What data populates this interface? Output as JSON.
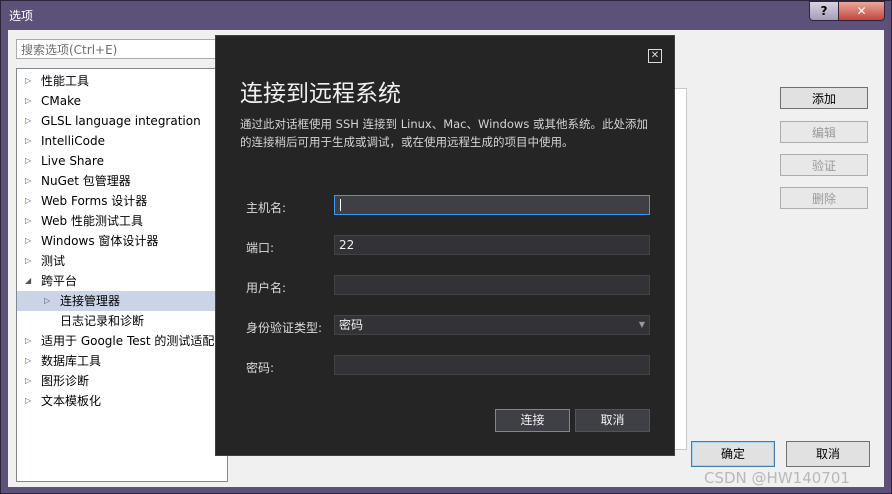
{
  "window": {
    "title": "选项",
    "help_glyph": "?",
    "close_glyph": "✕"
  },
  "search": {
    "placeholder": "搜索选项(Ctrl+E)"
  },
  "tree": {
    "items": [
      {
        "label": "性能工具",
        "expandable": true,
        "indent": 0,
        "selected": false
      },
      {
        "label": "CMake",
        "expandable": true,
        "indent": 0,
        "selected": false
      },
      {
        "label": "GLSL language integration",
        "expandable": true,
        "indent": 0,
        "selected": false
      },
      {
        "label": "IntelliCode",
        "expandable": true,
        "indent": 0,
        "selected": false
      },
      {
        "label": "Live Share",
        "expandable": true,
        "indent": 0,
        "selected": false
      },
      {
        "label": "NuGet 包管理器",
        "expandable": true,
        "indent": 0,
        "selected": false
      },
      {
        "label": "Web Forms 设计器",
        "expandable": true,
        "indent": 0,
        "selected": false
      },
      {
        "label": "Web 性能测试工具",
        "expandable": true,
        "indent": 0,
        "selected": false
      },
      {
        "label": "Windows 窗体设计器",
        "expandable": true,
        "indent": 0,
        "selected": false
      },
      {
        "label": "测试",
        "expandable": true,
        "indent": 0,
        "selected": false
      },
      {
        "label": "跨平台",
        "expandable": true,
        "expanded": true,
        "indent": 0,
        "selected": false
      },
      {
        "label": "连接管理器",
        "expandable": true,
        "indent": 1,
        "selected": true
      },
      {
        "label": "日志记录和诊断",
        "expandable": false,
        "indent": 1,
        "selected": false
      },
      {
        "label": "适用于 Google Test 的测试适配",
        "expandable": true,
        "indent": 0,
        "selected": false
      },
      {
        "label": "数据库工具",
        "expandable": true,
        "indent": 0,
        "selected": false
      },
      {
        "label": "图形诊断",
        "expandable": true,
        "indent": 0,
        "selected": false
      },
      {
        "label": "文本模板化",
        "expandable": true,
        "indent": 0,
        "selected": false
      }
    ]
  },
  "side_buttons": {
    "add": "添加",
    "edit": "编辑",
    "verify": "验证",
    "delete": "删除"
  },
  "footer": {
    "ok": "确定",
    "cancel": "取消"
  },
  "watermark": "CSDN @HW140701",
  "dialog": {
    "close_glyph": "✕",
    "title": "连接到远程系统",
    "description": "通过此对话框使用 SSH 连接到 Linux、Mac、Windows 或其他系统。此处添加的连接稍后可用于生成或调试，或在使用远程生成的项目中使用。",
    "fields": {
      "host": {
        "label": "主机名:",
        "value": ""
      },
      "port": {
        "label": "端口:",
        "value": "22"
      },
      "user": {
        "label": "用户名:",
        "value": ""
      },
      "auth": {
        "label": "身份验证类型:",
        "value": "密码"
      },
      "password": {
        "label": "密码:",
        "value": ""
      }
    },
    "connect": "连接",
    "cancel": "取消"
  }
}
